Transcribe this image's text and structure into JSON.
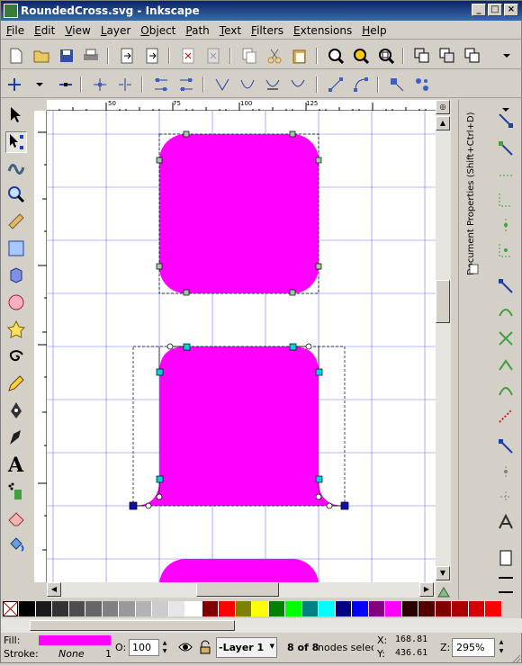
{
  "window": {
    "title": "RoundedCross.svg - Inkscape"
  },
  "menu": [
    "File",
    "Edit",
    "View",
    "Layer",
    "Object",
    "Path",
    "Text",
    "Filters",
    "Extensions",
    "Help"
  ],
  "ruler": {
    "h_labels": [
      "50",
      "75",
      "100",
      "125"
    ]
  },
  "dock": {
    "label": "Document Properties (Shift+Ctrl+D)"
  },
  "palette": [
    "#000000",
    "#1a1a1a",
    "#333333",
    "#4d4d4d",
    "#666666",
    "#808080",
    "#999999",
    "#b3b3b3",
    "#cccccc",
    "#e6e6e6",
    "#ffffff",
    "#800000",
    "#ff0000",
    "#808000",
    "#ffff00",
    "#008000",
    "#00ff00",
    "#008080",
    "#00ffff",
    "#000080",
    "#0000ff",
    "#800080",
    "#ff00ff",
    "#2b0000",
    "#550000",
    "#800000",
    "#aa0000",
    "#d40000",
    "#ff0000"
  ],
  "status": {
    "fill_label": "Fill:",
    "stroke_label": "Stroke:",
    "stroke_value": "None",
    "stroke_width": "1",
    "fill_color": "#ff00ff",
    "opacity_label": "O:",
    "opacity_value": "100",
    "layer": "-Layer 1",
    "message_bold": "8 of 8",
    "message": " nodes select",
    "x_label": "X:",
    "x_value": "168.81",
    "y_label": "Y:",
    "y_value": "436.61",
    "zoom_label": "Z:",
    "zoom_value": "295%"
  },
  "colors": {
    "shape": "#ff00ff",
    "guide": "#7070ff"
  }
}
